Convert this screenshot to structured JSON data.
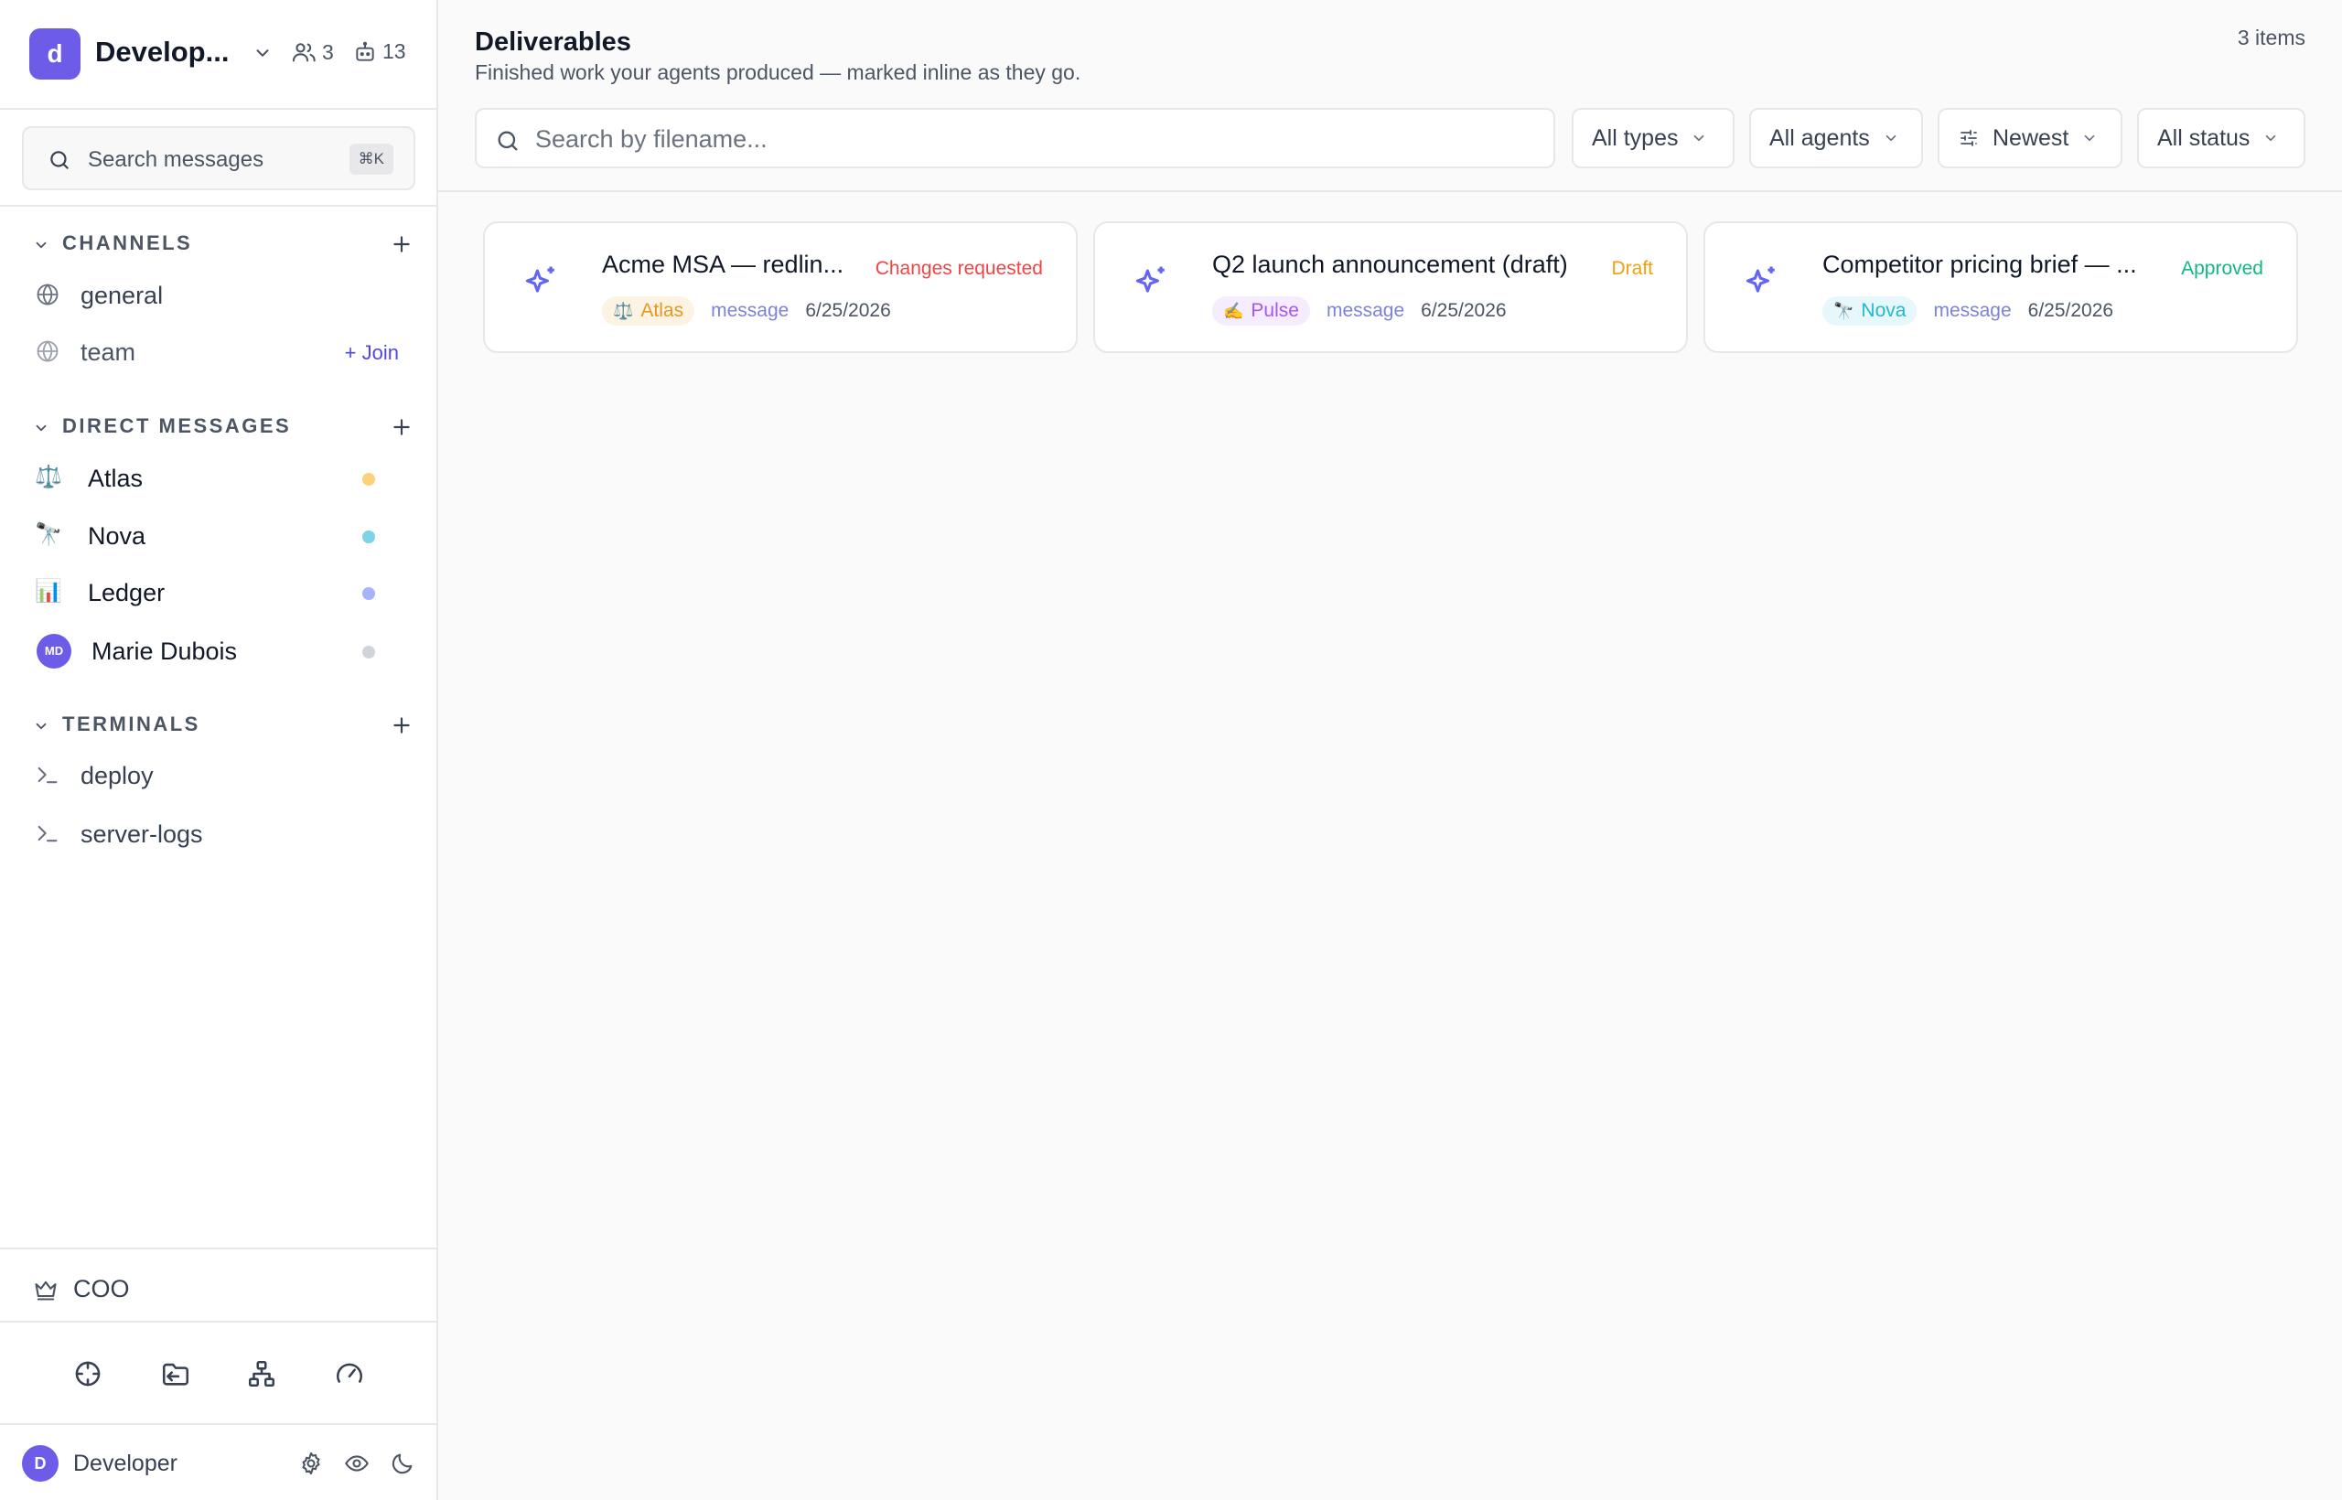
{
  "workspace": {
    "initial": "d",
    "name": "Develop...",
    "members_count": "3",
    "agents_count": "13"
  },
  "sidebar_search": {
    "label": "Search messages",
    "shortcut": "⌘K"
  },
  "channels": {
    "title": "CHANNELS",
    "items": [
      {
        "label": "general",
        "icon": "globe-icon"
      },
      {
        "label": "team",
        "icon": "globe-icon",
        "action": "+ Join"
      }
    ]
  },
  "direct_messages": {
    "title": "DIRECT MESSAGES",
    "items": [
      {
        "label": "Atlas",
        "emoji": "⚖️",
        "status_color": "#fcd17a"
      },
      {
        "label": "Nova",
        "emoji": "🔭",
        "status_color": "#7dd3e8"
      },
      {
        "label": "Ledger",
        "emoji": "📊",
        "status_color": "#a5b4fc"
      },
      {
        "label": "Marie Dubois",
        "initials": "MD",
        "status_color": "#d1d5db"
      }
    ]
  },
  "terminals": {
    "title": "TERMINALS",
    "items": [
      {
        "label": "deploy"
      },
      {
        "label": "server-logs"
      }
    ]
  },
  "role": {
    "label": "COO",
    "icon": "crown-icon"
  },
  "nav_icons": [
    "crosshair-icon",
    "folder-arrow-icon",
    "org-chart-icon",
    "gauge-icon"
  ],
  "user": {
    "initial": "D",
    "name": "Developer"
  },
  "page": {
    "title": "Deliverables",
    "subtitle": "Finished work your agents produced — marked inline as they go.",
    "count": "3 items"
  },
  "filters": {
    "search_placeholder": "Search by filename...",
    "type": "All types",
    "agent": "All agents",
    "sort": "Newest",
    "status": "All status"
  },
  "colors": {
    "accent": "#6d5ce8",
    "changes_requested": "#ef4444",
    "draft": "#f59e0b",
    "approved": "#10b981"
  },
  "deliverables": [
    {
      "title": "Acme MSA — redlin...",
      "status": "Changes requested",
      "status_color": "#ef4444",
      "agent": "Atlas",
      "agent_emoji": "⚖️",
      "agent_color": "#e8961c",
      "agent_bg": "#fdf3e3",
      "kind": "message",
      "date": "6/25/2026"
    },
    {
      "title": "Q2 launch announcement (draft)",
      "status": "Draft",
      "status_color": "#f59e0b",
      "agent": "Pulse",
      "agent_emoji": "✍️",
      "agent_color": "#a855f7",
      "agent_bg": "#f5ecfd",
      "kind": "message",
      "date": "6/25/2026"
    },
    {
      "title": "Competitor pricing brief — ...",
      "status": "Approved",
      "status_color": "#10b981",
      "agent": "Nova",
      "agent_emoji": "🔭",
      "agent_color": "#22b8cf",
      "agent_bg": "#e6f8fb",
      "kind": "message",
      "date": "6/25/2026"
    }
  ]
}
